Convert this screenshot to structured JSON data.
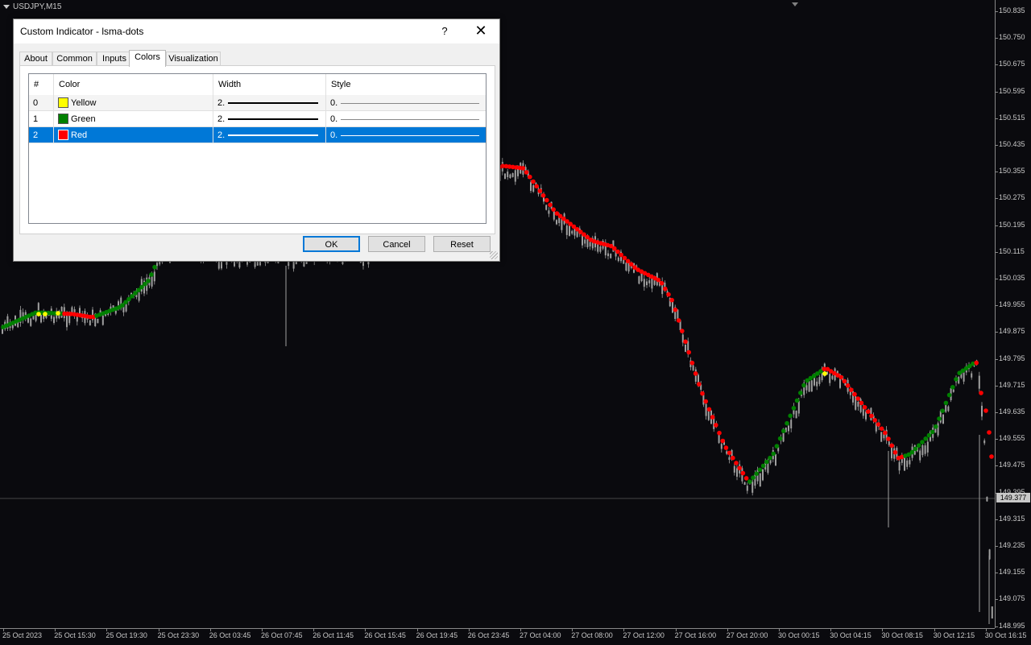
{
  "chart": {
    "symbol": "USDJPY,M15",
    "price_labels": [
      "150.835",
      "150.750",
      "150.675",
      "150.595",
      "150.515",
      "150.435",
      "150.355",
      "150.275",
      "150.195",
      "150.115",
      "150.035",
      "149.955",
      "149.875",
      "149.795",
      "149.715",
      "149.635",
      "149.555",
      "149.475",
      "149.395",
      "149.315",
      "149.235",
      "149.155",
      "149.075",
      "148.995"
    ],
    "current_price": "149.377",
    "time_labels": [
      "25 Oct 2023",
      "25 Oct 15:30",
      "25 Oct 19:30",
      "25 Oct 23:30",
      "26 Oct 03:45",
      "26 Oct 07:45",
      "26 Oct 11:45",
      "26 Oct 15:45",
      "26 Oct 19:45",
      "26 Oct 23:45",
      "27 Oct 04:00",
      "27 Oct 08:00",
      "27 Oct 12:00",
      "27 Oct 16:00",
      "27 Oct 20:00",
      "30 Oct 00:15",
      "30 Oct 04:15",
      "30 Oct 08:15",
      "30 Oct 12:15",
      "30 Oct 16:15"
    ],
    "colors": {
      "background": "#0a0a0e",
      "candle": "#a0a0a0",
      "dot_up": "#008000",
      "dot_down": "#ff0000",
      "dot_flat": "#ffff00"
    }
  },
  "dialog": {
    "title": "Custom Indicator - lsma-dots",
    "help_glyph": "?",
    "close_glyph": "✕",
    "tabs": [
      "About",
      "Common",
      "Inputs",
      "Colors",
      "Visualization"
    ],
    "active_tab": "Colors",
    "grid_headers": [
      "#",
      "Color",
      "Width",
      "Style"
    ],
    "rows": [
      {
        "index": "0",
        "color_name": "Yellow",
        "swatch": "#ffff00",
        "width": "2.",
        "style": "0."
      },
      {
        "index": "1",
        "color_name": "Green",
        "swatch": "#008000",
        "width": "2.",
        "style": "0."
      },
      {
        "index": "2",
        "color_name": "Red",
        "swatch": "#ff0000",
        "width": "2.",
        "style": "0."
      }
    ],
    "selected_row": 2,
    "buttons": {
      "ok": "OK",
      "cancel": "Cancel",
      "reset": "Reset"
    }
  }
}
